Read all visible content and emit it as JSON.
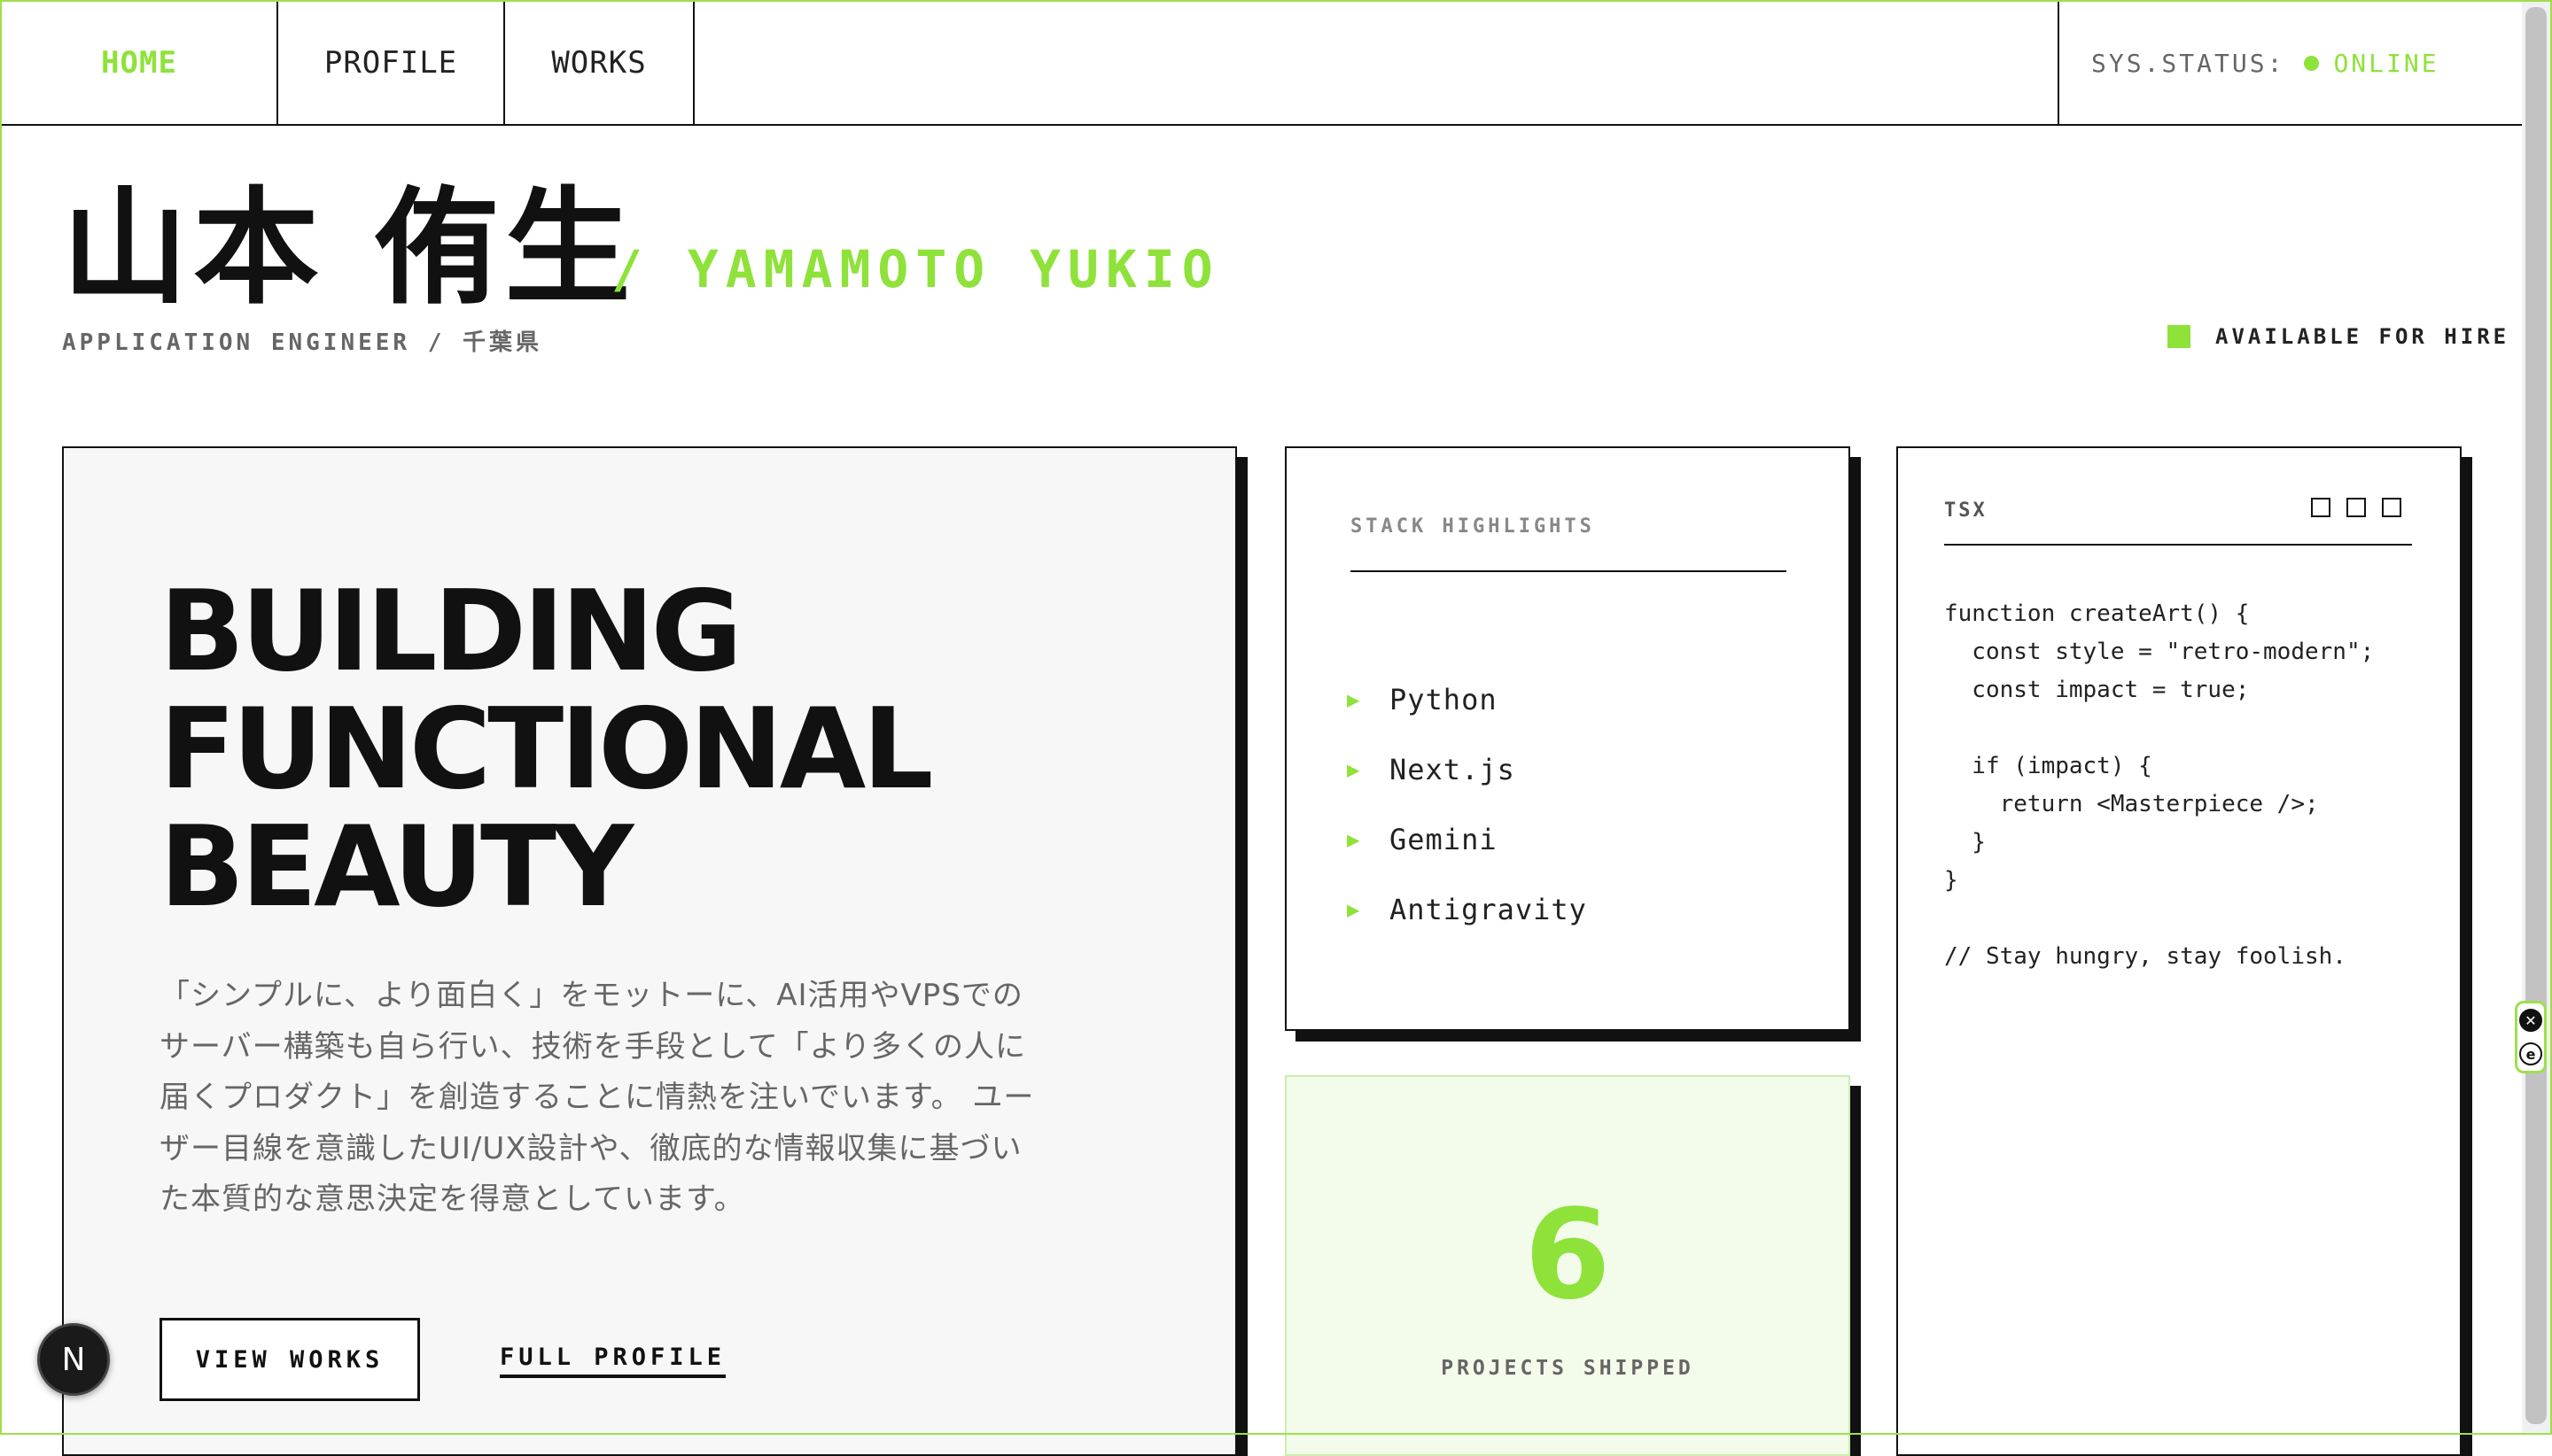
{
  "nav": {
    "items": [
      {
        "label": "HOME",
        "active": true
      },
      {
        "label": "PROFILE",
        "active": false
      },
      {
        "label": "WORKS",
        "active": false
      }
    ],
    "status_label": "SYS.STATUS:",
    "status_value": "ONLINE"
  },
  "hero": {
    "name_jp": "山本 侑生",
    "name_en": "/ YAMAMOTO YUKIO",
    "subtitle": "APPLICATION ENGINEER / 千葉県",
    "availability": "AVAILABLE FOR HIRE"
  },
  "main": {
    "headline": [
      "BUILDING",
      "FUNCTIONAL",
      "BEAUTY"
    ],
    "description": "「シンプルに、より面白く」をモットーに、AI活用やVPSでのサーバー構築も自ら行い、技術を手段として「より多くの人に届くプロダクト」を創造することに情熱を注いでいます。 ユーザー目線を意識したUI/UX設計や、徹底的な情報収集に基づいた本質的な意思決定を得意としています。",
    "view_works_label": "VIEW WORKS",
    "full_profile_label": "FULL PROFILE"
  },
  "stack": {
    "title": "STACK HIGHLIGHTS",
    "items": [
      "Python",
      "Next.js",
      "Gemini",
      "Antigravity"
    ]
  },
  "stat": {
    "value": "6",
    "label": "PROJECTS SHIPPED"
  },
  "code_card": {
    "tag": "TSX",
    "code": "function createArt() {\n  const style = \"retro-modern\";\n  const impact = true;\n\n  if (impact) {\n    return <Masterpiece />;\n  }\n}\n\n// Stay hungry, stay foolish."
  },
  "floating": {
    "next_badge": "N",
    "ext_close": "✕",
    "ext_logo": "e"
  },
  "colors": {
    "accent": "#8ee23a",
    "text": "#111111",
    "muted": "#666666",
    "border": "#111111",
    "stat_bg": "#f3fbea"
  }
}
